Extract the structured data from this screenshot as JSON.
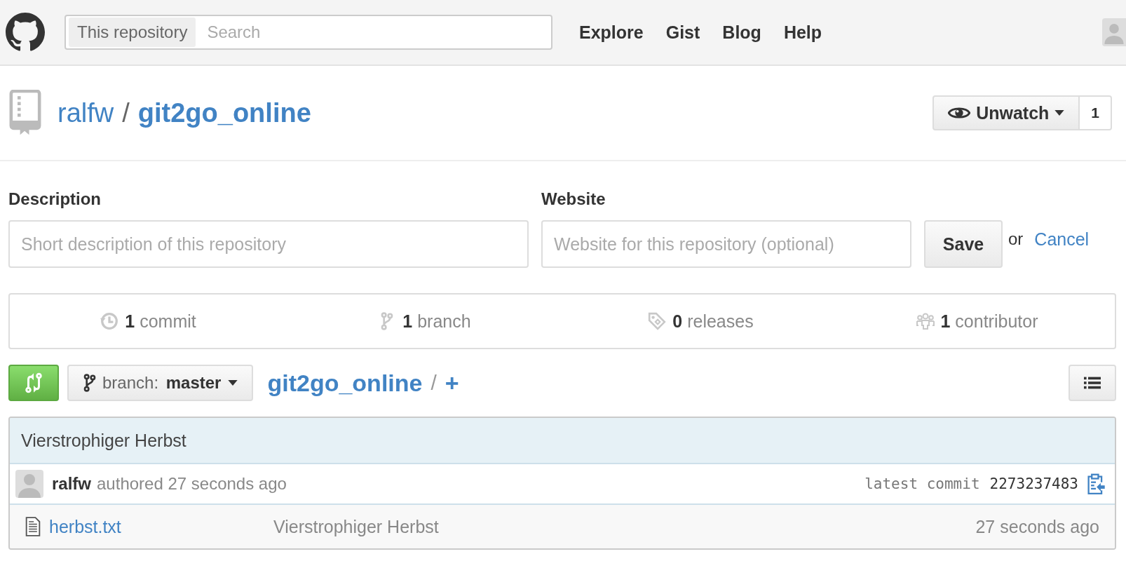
{
  "header": {
    "search_scope": "This repository",
    "search": {
      "placeholder": "Search"
    },
    "nav": [
      "Explore",
      "Gist",
      "Blog",
      "Help"
    ]
  },
  "repo": {
    "owner": "ralfw",
    "separator": "/",
    "name": "git2go_online",
    "watch": {
      "label": "Unwatch",
      "count": "1"
    }
  },
  "edit": {
    "description": {
      "label": "Description",
      "placeholder": "Short description of this repository"
    },
    "website": {
      "label": "Website",
      "placeholder": "Website for this repository (optional)"
    },
    "save": "Save",
    "or": "or",
    "cancel": "Cancel"
  },
  "stats": [
    {
      "kind": "commits",
      "text": "**1** commit"
    },
    {
      "kind": "branches",
      "text": "**1** branch"
    },
    {
      "kind": "releases",
      "text": "**0** releases"
    },
    {
      "kind": "contributors",
      "text": "**1** contributor"
    }
  ],
  "toolbar": {
    "branch_prefix": "branch:",
    "branch": "master",
    "path_repo": "git2go_online",
    "path_sep": "/",
    "path_add": "+"
  },
  "commit": {
    "message": "Vierstrophiger Herbst",
    "author": "ralfw",
    "authored": "authored 27 seconds ago",
    "latest_label": "latest commit",
    "sha": "2273237483"
  },
  "files": [
    {
      "name": "herbst.txt",
      "message": "Vierstrophiger Herbst",
      "age": "27 seconds ago"
    }
  ]
}
